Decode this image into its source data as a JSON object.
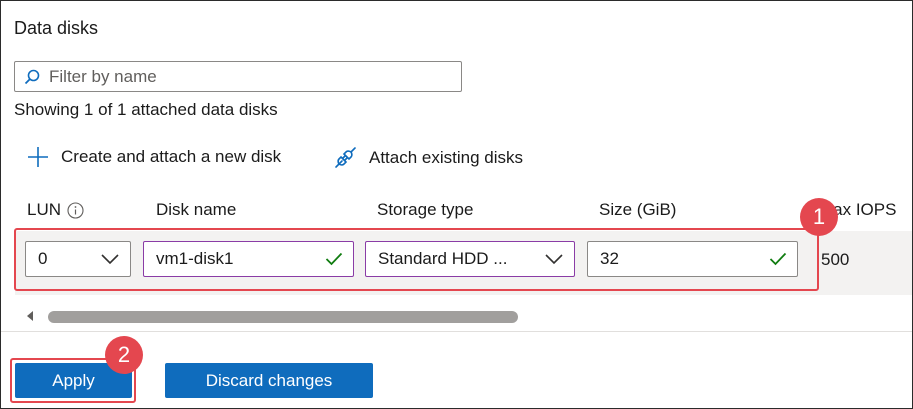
{
  "section": {
    "title": "Data disks"
  },
  "filter": {
    "placeholder": "Filter by name",
    "value": ""
  },
  "summary": {
    "showing": "Showing 1 of 1 attached data disks"
  },
  "commands": {
    "create": {
      "label": "Create and attach a new disk",
      "icon": "plus-icon"
    },
    "attach": {
      "label": "Attach existing disks",
      "icon": "plug-icon"
    }
  },
  "table": {
    "columns": {
      "lun": "LUN",
      "disk_name": "Disk name",
      "storage_type": "Storage type",
      "size": "Size (GiB)",
      "max_iops": "Max IOPS"
    },
    "row": {
      "lun": "0",
      "disk_name": "vm1-disk1",
      "storage_type": "Standard HDD ...",
      "size": "32",
      "max_iops": "500"
    }
  },
  "buttons": {
    "apply": "Apply",
    "discard": "Discard changes"
  },
  "callouts": {
    "one": "1",
    "two": "2"
  },
  "colors": {
    "accent": "#0f6cbd",
    "highlight": "#e4474f",
    "valid": "#107c10",
    "focus_border": "#8a3ca6"
  }
}
